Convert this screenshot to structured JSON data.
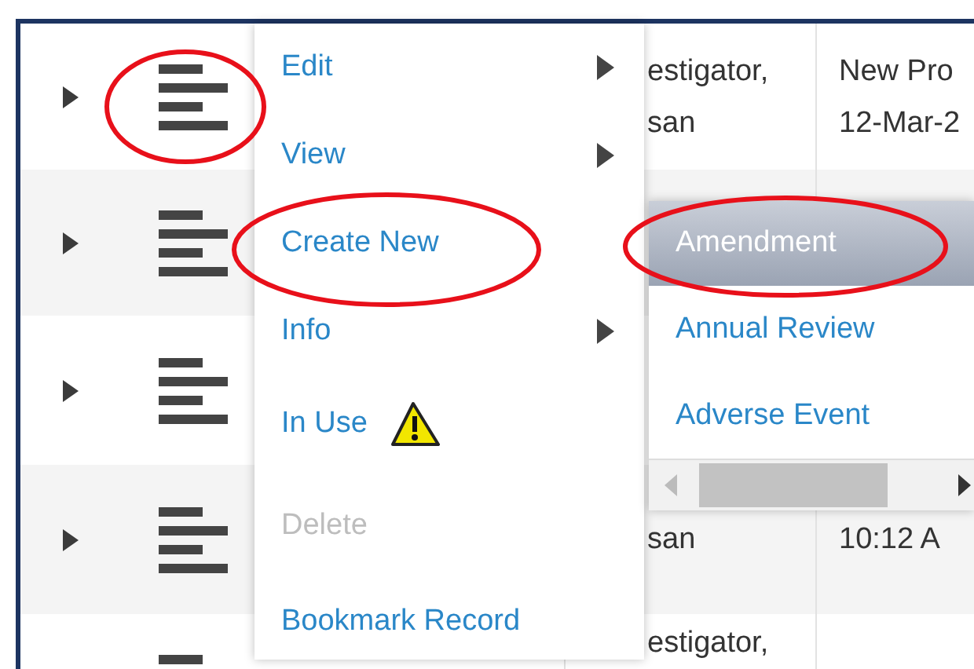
{
  "table": {
    "rows": [
      {
        "expanded": false,
        "column_4": [
          "estigator,",
          "san"
        ],
        "column_5": [
          "New Pro",
          "12-Mar-2"
        ]
      },
      {
        "expanded": false
      },
      {
        "expanded": false
      },
      {
        "expanded": false,
        "column_4": [
          "san"
        ],
        "column_5": [
          "10:12 A"
        ]
      },
      {
        "column_4": [
          "estigator,"
        ]
      }
    ]
  },
  "context_menu": {
    "items": [
      {
        "label": "Edit",
        "has_submenu": true,
        "warning": false,
        "disabled": false
      },
      {
        "label": "View",
        "has_submenu": true,
        "warning": false,
        "disabled": false
      },
      {
        "label": "Create New",
        "has_submenu": false,
        "warning": false,
        "disabled": false
      },
      {
        "label": "Info",
        "has_submenu": true,
        "warning": false,
        "disabled": false
      },
      {
        "label": "In Use",
        "has_submenu": false,
        "warning": true,
        "disabled": false
      },
      {
        "label": "Delete",
        "has_submenu": false,
        "warning": false,
        "disabled": true
      },
      {
        "label": "Bookmark Record",
        "has_submenu": false,
        "warning": false,
        "disabled": false
      }
    ]
  },
  "submenu": {
    "items": [
      {
        "label": "Amendment",
        "selected": true
      },
      {
        "label": "Annual Review",
        "selected": false
      },
      {
        "label": "Adverse Event",
        "selected": false
      }
    ]
  }
}
